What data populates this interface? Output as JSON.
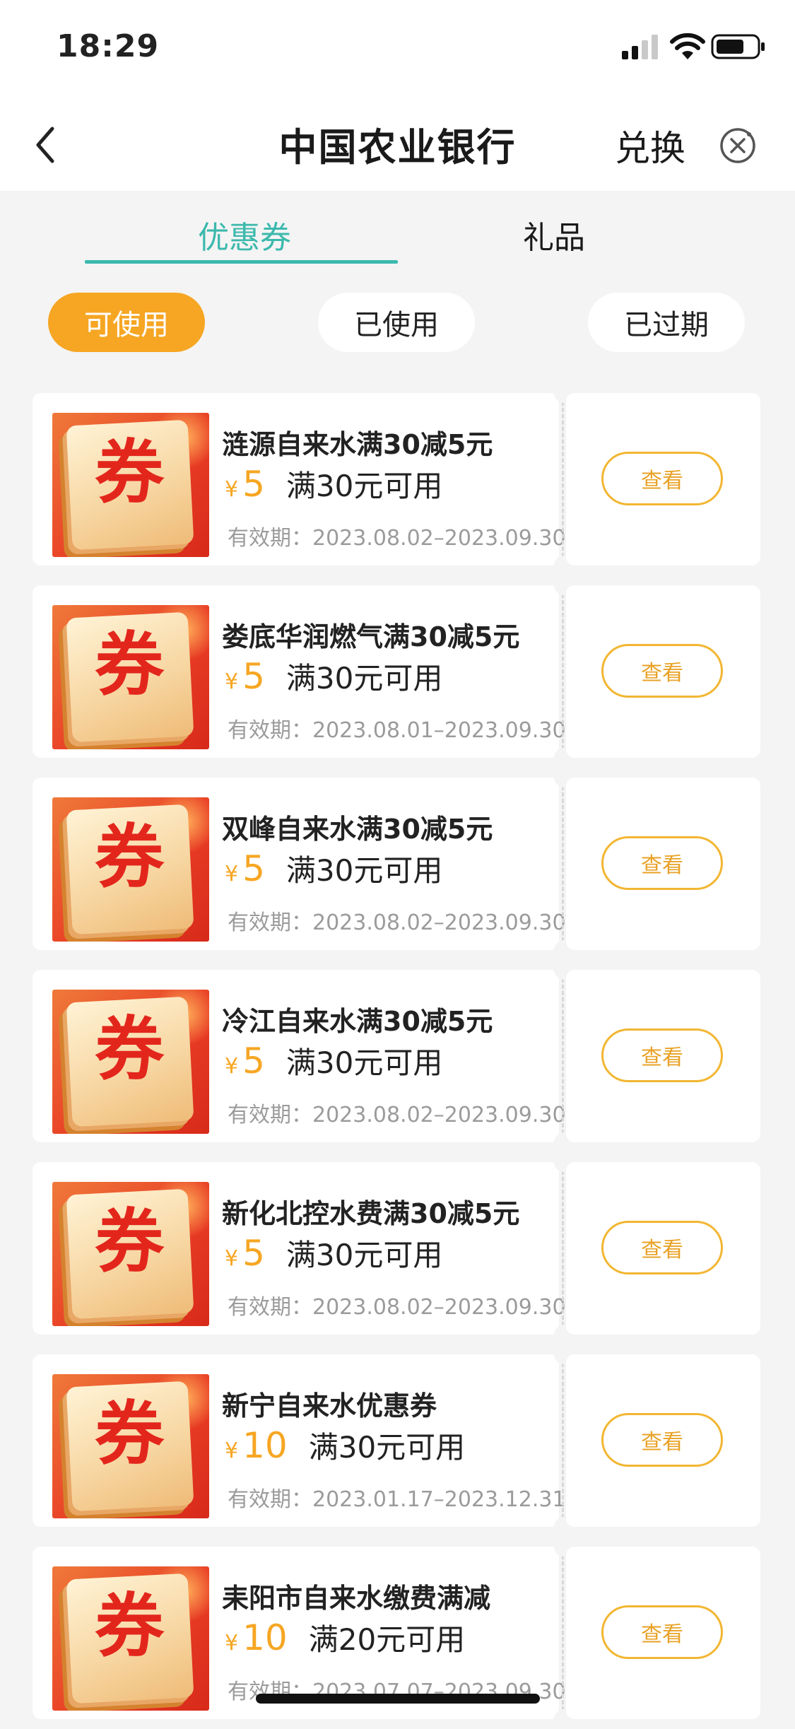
{
  "status_bar": {
    "time": "18:29"
  },
  "header": {
    "title": "中国农业银行",
    "exchange_label": "兑换"
  },
  "tabs": [
    {
      "label": "优惠券",
      "active": true
    },
    {
      "label": "礼品",
      "active": false
    }
  ],
  "filters": {
    "available": "可使用",
    "used": "已使用",
    "expired": "已过期",
    "selected": "可使用"
  },
  "coupon_icon": {
    "label": "券",
    "icon": "coupon-ticket-icon"
  },
  "currency_symbol": "¥",
  "view_label": "查看",
  "colors": {
    "accent": "#3cb9ad",
    "orange": "#f6a623",
    "ticket_red": "#e83b24"
  },
  "coupons": [
    {
      "title": "涟源自来水满30减5元",
      "amount": "5",
      "condition": "满30元可用",
      "validity": "有效期：2023.08.02–2023.09.30"
    },
    {
      "title": "娄底华润燃气满30减5元",
      "amount": "5",
      "condition": "满30元可用",
      "validity": "有效期：2023.08.01–2023.09.30"
    },
    {
      "title": "双峰自来水满30减5元",
      "amount": "5",
      "condition": "满30元可用",
      "validity": "有效期：2023.08.02–2023.09.30"
    },
    {
      "title": "冷江自来水满30减5元",
      "amount": "5",
      "condition": "满30元可用",
      "validity": "有效期：2023.08.02–2023.09.30"
    },
    {
      "title": "新化北控水费满30减5元",
      "amount": "5",
      "condition": "满30元可用",
      "validity": "有效期：2023.08.02–2023.09.30"
    },
    {
      "title": "新宁自来水优惠券",
      "amount": "10",
      "condition": "满30元可用",
      "validity": "有效期：2023.01.17–2023.12.31"
    },
    {
      "title": "耒阳市自来水缴费满减",
      "amount": "10",
      "condition": "满20元可用",
      "validity": "有效期：2023.07.07–2023.09.30"
    }
  ]
}
